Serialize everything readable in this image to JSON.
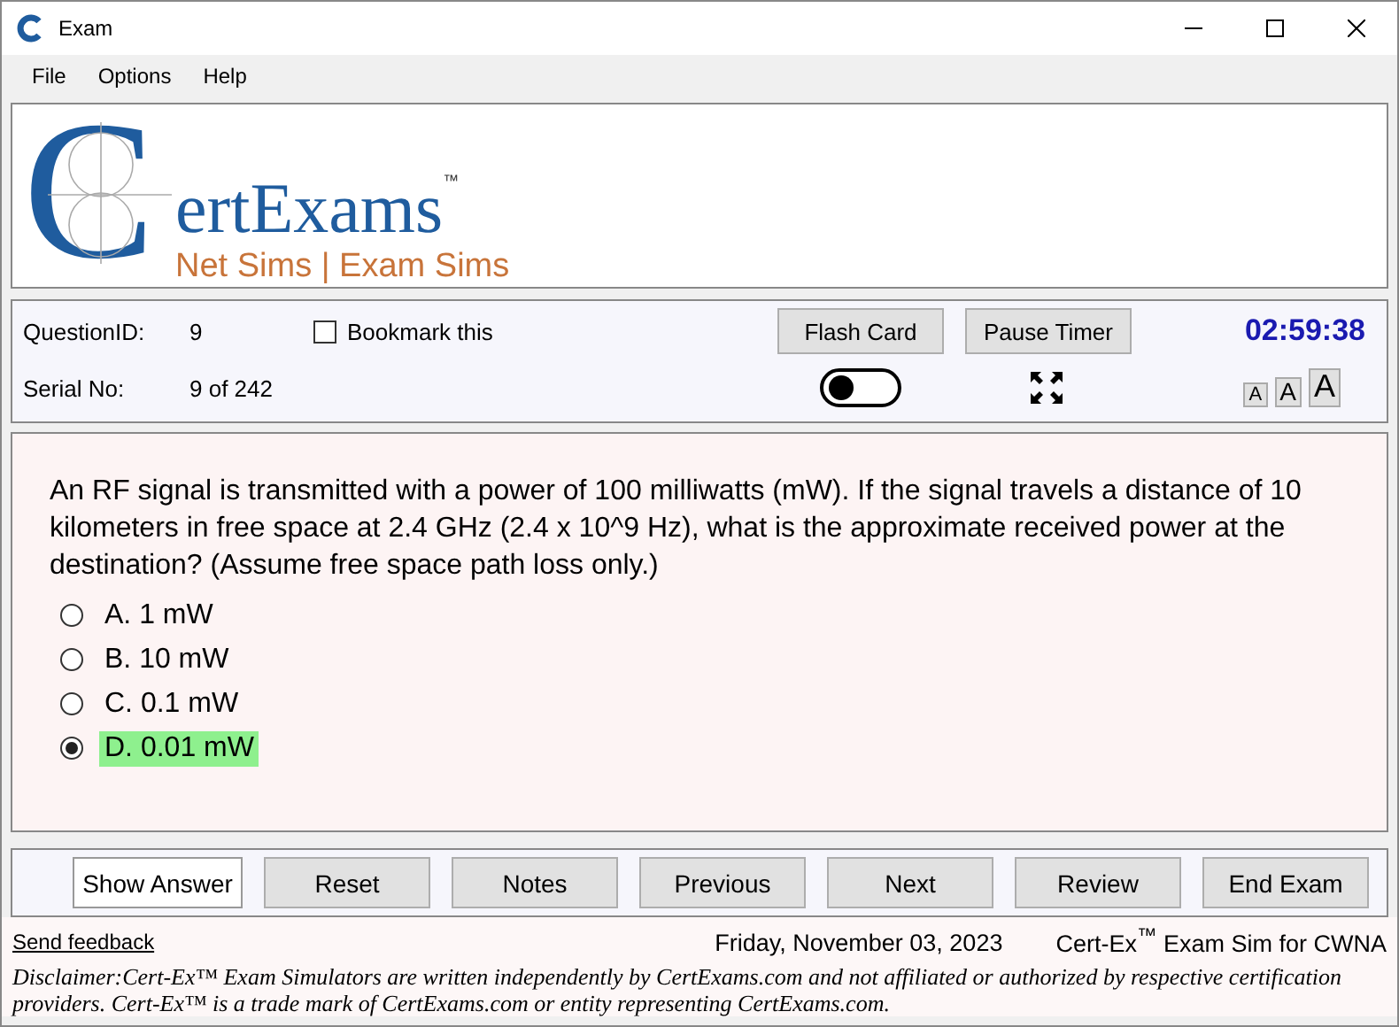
{
  "window": {
    "title": "Exam"
  },
  "menu": [
    "File",
    "Options",
    "Help"
  ],
  "logo": {
    "initial": "C",
    "name": "ertExams",
    "trademark": "™",
    "tagline": "Net Sims | Exam Sims"
  },
  "info": {
    "question_id_label": "QuestionID:",
    "question_id": "9",
    "serial_label": "Serial No:",
    "serial": "9 of 242",
    "bookmark": {
      "label": "Bookmark this",
      "checked": false
    },
    "flash_card_button": "Flash Card",
    "pause_timer_button": "Pause Timer",
    "flash_toggle": {
      "on": false
    },
    "timer": "02:59:38",
    "font_sizes": [
      "A",
      "A",
      "A"
    ]
  },
  "question": {
    "text": "An RF signal is transmitted with a power of 100 milliwatts (mW). If the signal travels a distance of 10 kilometers in free space at 2.4 GHz (2.4 x 10^9 Hz), what is the approximate received power at the destination? (Assume free space path loss only.)",
    "options": [
      {
        "label": "A. 1 mW",
        "selected": false,
        "highlighted": false
      },
      {
        "label": "B. 10 mW",
        "selected": false,
        "highlighted": false
      },
      {
        "label": "C. 0.1 mW",
        "selected": false,
        "highlighted": false
      },
      {
        "label": "D. 0.01 mW",
        "selected": true,
        "highlighted": true
      }
    ]
  },
  "buttons": [
    {
      "label": "Show Answer",
      "selected": true
    },
    {
      "label": "Reset",
      "selected": false
    },
    {
      "label": "Notes",
      "selected": false
    },
    {
      "label": "Previous",
      "selected": false
    },
    {
      "label": "Next",
      "selected": false
    },
    {
      "label": "Review",
      "selected": false
    },
    {
      "label": "End Exam",
      "selected": false
    }
  ],
  "footer": {
    "feedback_link": "Send feedback",
    "date": "Friday, November 03, 2023",
    "product": "Cert-Ex$^{™}$ Exam Sim for CWNA",
    "disclaimer": "Disclaimer:Cert-Ex™ Exam Simulators are written independently by CertExams.com and not affiliated or authorized by respective certification providers. Cert-Ex™ is a trade mark of CertExams.com or entity representing CertExams.com."
  }
}
